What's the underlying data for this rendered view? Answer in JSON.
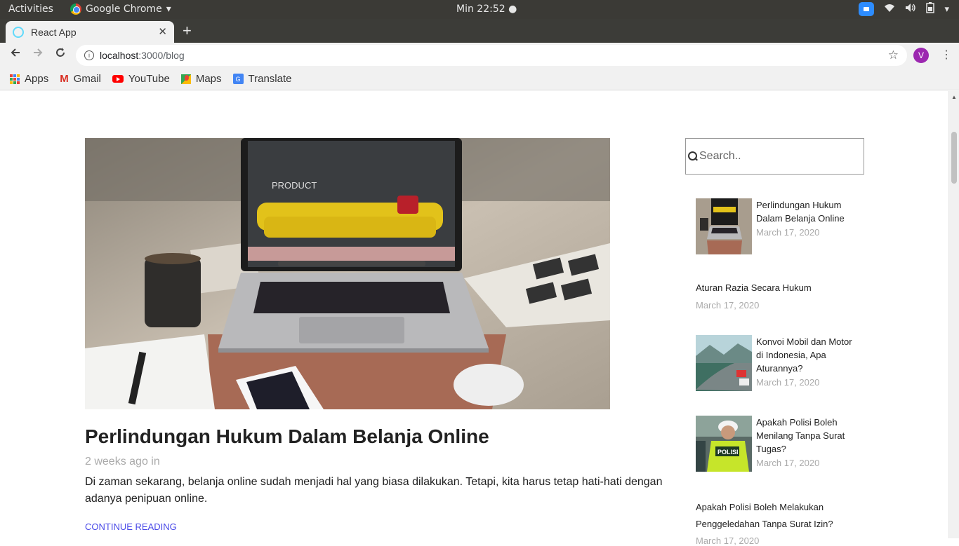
{
  "gnome": {
    "activities": "Activities",
    "app_name": "Google Chrome",
    "app_arrow": "▾",
    "clock": "Min 22:52 ●",
    "tray_arrow": "▾"
  },
  "browser": {
    "tab_title": "React App",
    "tab_close": "✕",
    "new_tab": "+",
    "url_host": "localhost",
    "url_path": ":3000/blog",
    "avatar_letter": "V",
    "bookmarks": [
      {
        "label": "Apps",
        "icon": "apps-grid-icon"
      },
      {
        "label": "Gmail",
        "icon": "gmail-icon"
      },
      {
        "label": "YouTube",
        "icon": "youtube-icon"
      },
      {
        "label": "Maps",
        "icon": "maps-icon"
      },
      {
        "label": "Translate",
        "icon": "translate-icon"
      }
    ]
  },
  "post": {
    "title": "Perlindungan Hukum Dalam Belanja Online",
    "meta": "2 weeks ago in",
    "excerpt": "Di zaman sekarang, belanja online sudah menjadi hal yang biasa dilakukan. Tetapi, kita harus tetap hati-hati dengan adanya penipuan online.",
    "continue_label": "CONTINUE READING",
    "screen_text": "PRODUCT"
  },
  "sidebar": {
    "search_placeholder": "Search..",
    "items": [
      {
        "title": "Perlindungan Hukum Dalam Belanja Online",
        "date": "March 17, 2020",
        "thumb": "laptop"
      },
      {
        "title": "Aturan Razia Secara Hukum",
        "date": "March 17, 2020",
        "thumb": null
      },
      {
        "title": "Konvoi Mobil dan Motor di Indonesia, Apa Aturannya?",
        "date": "March 17, 2020",
        "thumb": "road"
      },
      {
        "title": "Apakah Polisi Boleh Menilang Tanpa Surat Tugas?",
        "date": "March 17, 2020",
        "thumb": "police"
      },
      {
        "title": "Apakah Polisi Boleh Melakukan Penggeledahan Tanpa Surat Izin?",
        "date": "March 17, 2020",
        "thumb": null
      }
    ]
  },
  "colors": {
    "link": "#4a4ae8",
    "avatar": "#9c27b0",
    "topbar": "#3b3a36"
  }
}
